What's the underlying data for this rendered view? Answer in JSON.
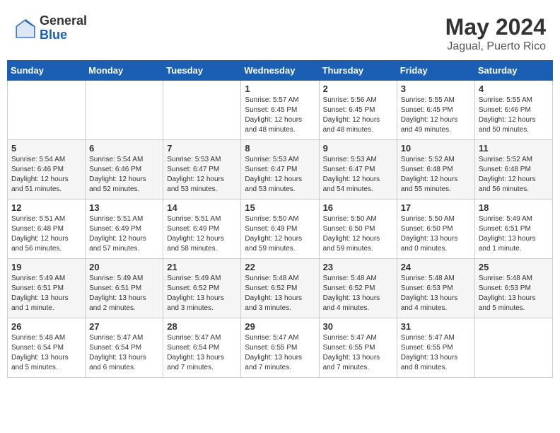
{
  "header": {
    "logo_general": "General",
    "logo_blue": "Blue",
    "month_year": "May 2024",
    "location": "Jagual, Puerto Rico"
  },
  "days_of_week": [
    "Sunday",
    "Monday",
    "Tuesday",
    "Wednesday",
    "Thursday",
    "Friday",
    "Saturday"
  ],
  "weeks": [
    [
      {
        "day": "",
        "info": ""
      },
      {
        "day": "",
        "info": ""
      },
      {
        "day": "",
        "info": ""
      },
      {
        "day": "1",
        "info": "Sunrise: 5:57 AM\nSunset: 6:45 PM\nDaylight: 12 hours\nand 48 minutes."
      },
      {
        "day": "2",
        "info": "Sunrise: 5:56 AM\nSunset: 6:45 PM\nDaylight: 12 hours\nand 48 minutes."
      },
      {
        "day": "3",
        "info": "Sunrise: 5:55 AM\nSunset: 6:45 PM\nDaylight: 12 hours\nand 49 minutes."
      },
      {
        "day": "4",
        "info": "Sunrise: 5:55 AM\nSunset: 6:46 PM\nDaylight: 12 hours\nand 50 minutes."
      }
    ],
    [
      {
        "day": "5",
        "info": "Sunrise: 5:54 AM\nSunset: 6:46 PM\nDaylight: 12 hours\nand 51 minutes."
      },
      {
        "day": "6",
        "info": "Sunrise: 5:54 AM\nSunset: 6:46 PM\nDaylight: 12 hours\nand 52 minutes."
      },
      {
        "day": "7",
        "info": "Sunrise: 5:53 AM\nSunset: 6:47 PM\nDaylight: 12 hours\nand 53 minutes."
      },
      {
        "day": "8",
        "info": "Sunrise: 5:53 AM\nSunset: 6:47 PM\nDaylight: 12 hours\nand 53 minutes."
      },
      {
        "day": "9",
        "info": "Sunrise: 5:53 AM\nSunset: 6:47 PM\nDaylight: 12 hours\nand 54 minutes."
      },
      {
        "day": "10",
        "info": "Sunrise: 5:52 AM\nSunset: 6:48 PM\nDaylight: 12 hours\nand 55 minutes."
      },
      {
        "day": "11",
        "info": "Sunrise: 5:52 AM\nSunset: 6:48 PM\nDaylight: 12 hours\nand 56 minutes."
      }
    ],
    [
      {
        "day": "12",
        "info": "Sunrise: 5:51 AM\nSunset: 6:48 PM\nDaylight: 12 hours\nand 56 minutes."
      },
      {
        "day": "13",
        "info": "Sunrise: 5:51 AM\nSunset: 6:49 PM\nDaylight: 12 hours\nand 57 minutes."
      },
      {
        "day": "14",
        "info": "Sunrise: 5:51 AM\nSunset: 6:49 PM\nDaylight: 12 hours\nand 58 minutes."
      },
      {
        "day": "15",
        "info": "Sunrise: 5:50 AM\nSunset: 6:49 PM\nDaylight: 12 hours\nand 59 minutes."
      },
      {
        "day": "16",
        "info": "Sunrise: 5:50 AM\nSunset: 6:50 PM\nDaylight: 12 hours\nand 59 minutes."
      },
      {
        "day": "17",
        "info": "Sunrise: 5:50 AM\nSunset: 6:50 PM\nDaylight: 13 hours\nand 0 minutes."
      },
      {
        "day": "18",
        "info": "Sunrise: 5:49 AM\nSunset: 6:51 PM\nDaylight: 13 hours\nand 1 minute."
      }
    ],
    [
      {
        "day": "19",
        "info": "Sunrise: 5:49 AM\nSunset: 6:51 PM\nDaylight: 13 hours\nand 1 minute."
      },
      {
        "day": "20",
        "info": "Sunrise: 5:49 AM\nSunset: 6:51 PM\nDaylight: 13 hours\nand 2 minutes."
      },
      {
        "day": "21",
        "info": "Sunrise: 5:49 AM\nSunset: 6:52 PM\nDaylight: 13 hours\nand 3 minutes."
      },
      {
        "day": "22",
        "info": "Sunrise: 5:48 AM\nSunset: 6:52 PM\nDaylight: 13 hours\nand 3 minutes."
      },
      {
        "day": "23",
        "info": "Sunrise: 5:48 AM\nSunset: 6:52 PM\nDaylight: 13 hours\nand 4 minutes."
      },
      {
        "day": "24",
        "info": "Sunrise: 5:48 AM\nSunset: 6:53 PM\nDaylight: 13 hours\nand 4 minutes."
      },
      {
        "day": "25",
        "info": "Sunrise: 5:48 AM\nSunset: 6:53 PM\nDaylight: 13 hours\nand 5 minutes."
      }
    ],
    [
      {
        "day": "26",
        "info": "Sunrise: 5:48 AM\nSunset: 6:54 PM\nDaylight: 13 hours\nand 5 minutes."
      },
      {
        "day": "27",
        "info": "Sunrise: 5:47 AM\nSunset: 6:54 PM\nDaylight: 13 hours\nand 6 minutes."
      },
      {
        "day": "28",
        "info": "Sunrise: 5:47 AM\nSunset: 6:54 PM\nDaylight: 13 hours\nand 7 minutes."
      },
      {
        "day": "29",
        "info": "Sunrise: 5:47 AM\nSunset: 6:55 PM\nDaylight: 13 hours\nand 7 minutes."
      },
      {
        "day": "30",
        "info": "Sunrise: 5:47 AM\nSunset: 6:55 PM\nDaylight: 13 hours\nand 7 minutes."
      },
      {
        "day": "31",
        "info": "Sunrise: 5:47 AM\nSunset: 6:55 PM\nDaylight: 13 hours\nand 8 minutes."
      },
      {
        "day": "",
        "info": ""
      }
    ]
  ]
}
